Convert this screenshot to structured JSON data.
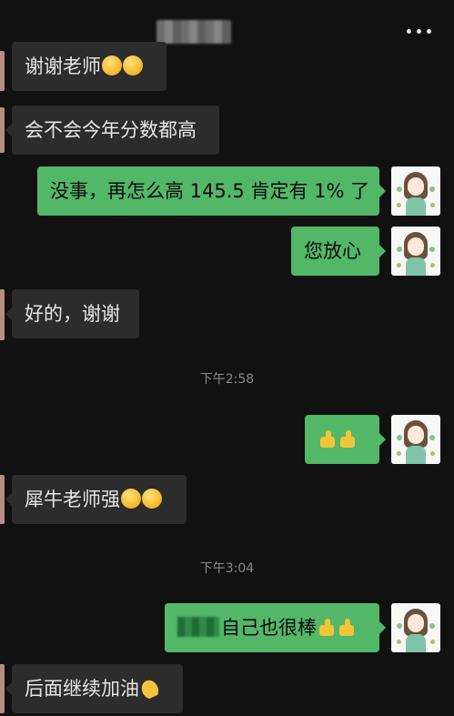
{
  "header": {
    "title": "",
    "more_icon": "more-dots-icon"
  },
  "messages": [
    {
      "side": "in",
      "text": "谢谢老师",
      "emoji": "smile-emoji-x2"
    },
    {
      "side": "in",
      "text": "会不会今年分数都高"
    },
    {
      "side": "out",
      "text": "没事，再怎么高 145.5 肯定有 1% 了"
    },
    {
      "side": "out",
      "text": "您放心"
    },
    {
      "side": "in",
      "text": "好的，谢谢"
    },
    {
      "side": "out",
      "text": "",
      "emoji": "thumbs-up-x2"
    },
    {
      "side": "in",
      "text": "犀牛老师强",
      "emoji": "grin-emoji-x2"
    },
    {
      "side": "out",
      "text": "自己也很棒",
      "emoji": "thumbs-up-x2"
    },
    {
      "side": "in",
      "text": "后面继续加油",
      "emoji": "clap-emoji"
    }
  ],
  "timestamps": [
    "下午2:58",
    "下午3:04"
  ],
  "colors": {
    "background": "#111111",
    "incoming_bubble": "#2c2c2c",
    "outgoing_bubble": "#53b768"
  }
}
